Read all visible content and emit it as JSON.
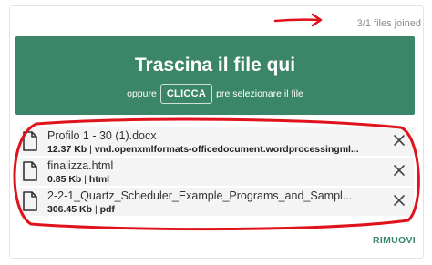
{
  "status": {
    "text": "3/1 files joined"
  },
  "dropzone": {
    "title": "Trascina il file qui",
    "sub_prefix": "oppure",
    "browse_label": "CLICCA",
    "sub_suffix": "pre selezionare il file",
    "bg_color": "#3b8668"
  },
  "files": [
    {
      "name": "Profilo 1 - 30 (1).docx",
      "size": "12.37 Kb",
      "type": "vnd.openxmlformats-officedocument.wordprocessingml...",
      "icon": "document-icon"
    },
    {
      "name": "finalizza.html",
      "size": "0.85 Kb",
      "type": "html",
      "icon": "document-icon"
    },
    {
      "name": "2-2-1_Quartz_Scheduler_Example_Programs_and_Sampl...",
      "size": "306.45 Kb",
      "type": "pdf",
      "icon": "document-icon"
    }
  ],
  "remove_all_label": "RIMUOVI",
  "annotation_color": "#e0121b"
}
